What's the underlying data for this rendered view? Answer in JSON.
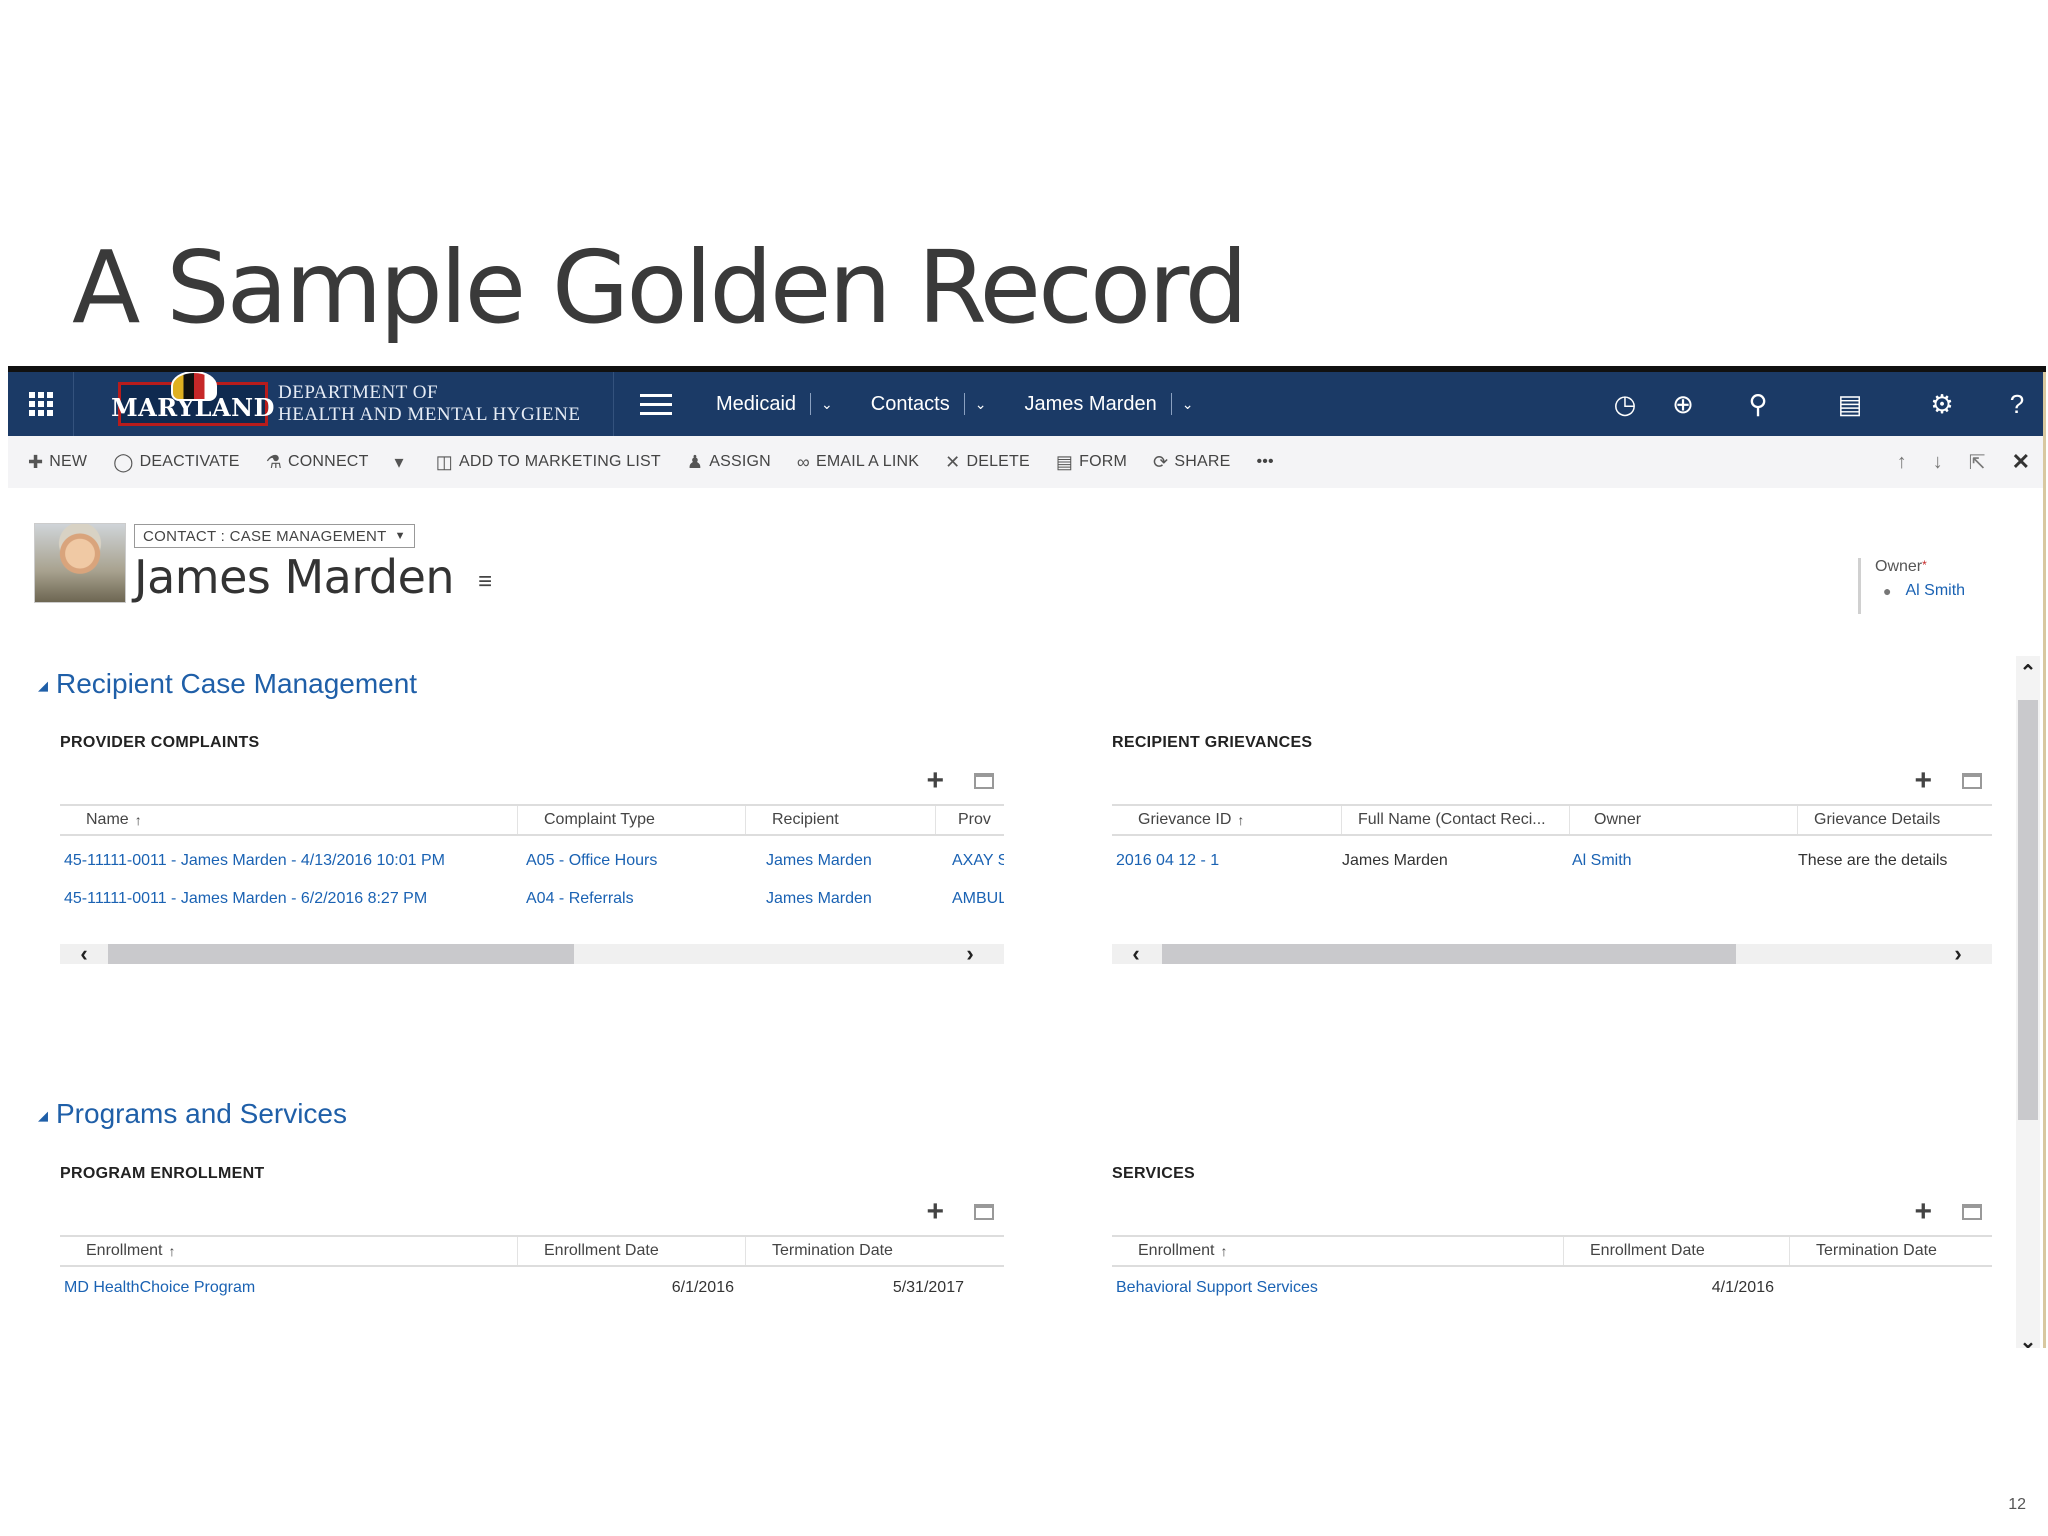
{
  "slide": {
    "title": "A Sample Golden Record",
    "page_number": "12"
  },
  "navbar": {
    "logo_word": "MARYLAND",
    "dept_line1": "DEPARTMENT OF",
    "dept_line2": "HEALTH AND MENTAL HYGIENE",
    "crumbs": [
      "Medicaid",
      "Contacts",
      "James Marden"
    ],
    "icons": [
      "grid-icon",
      "hamburger-icon",
      "history-icon",
      "add-icon",
      "search-icon",
      "advanced-find-icon",
      "gear-icon",
      "help-icon"
    ],
    "help": "?",
    "bg_color": "#1b3a66"
  },
  "commands": {
    "new": "NEW",
    "deactivate": "DEACTIVATE",
    "connect": "CONNECT",
    "add_to_marketing_list": "ADD TO MARKETING LIST",
    "assign": "ASSIGN",
    "email_a_link": "EMAIL A LINK",
    "delete": "DELETE",
    "form": "FORM",
    "share": "SHARE",
    "more": "•••"
  },
  "record": {
    "form_selector": "CONTACT : CASE MANAGEMENT",
    "name": "James Marden",
    "owner_label": "Owner",
    "owner_required": "*",
    "owner_value": "Al Smith"
  },
  "sections": {
    "case_management": "Recipient Case Management",
    "programs": "Programs and Services"
  },
  "provider_complaints": {
    "title": "PROVIDER COMPLAINTS",
    "columns": [
      "Name",
      "Complaint Type",
      "Recipient",
      "Prov"
    ],
    "rows": [
      [
        "45-11111-0011 - James Marden - 4/13/2016 10:01 PM",
        "A05 - Office Hours",
        "James Marden",
        "AXAY S"
      ],
      [
        "45-11111-0011 - James Marden - 6/2/2016 8:27 PM",
        "A04 - Referrals",
        "James Marden",
        "AMBUL"
      ]
    ]
  },
  "recipient_grievances": {
    "title": "RECIPIENT GRIEVANCES",
    "columns": [
      "Grievance ID",
      "Full Name (Contact Reci...",
      "Owner",
      "Grievance Details"
    ],
    "rows": [
      [
        "2016 04 12 - 1",
        "James Marden",
        "Al Smith",
        "These are the details"
      ]
    ]
  },
  "program_enrollment": {
    "title": "PROGRAM ENROLLMENT",
    "columns": [
      "Enrollment",
      "Enrollment Date",
      "Termination Date"
    ],
    "rows": [
      [
        "MD HealthChoice Program",
        "6/1/2016",
        "5/31/2017"
      ]
    ]
  },
  "services": {
    "title": "SERVICES",
    "columns": [
      "Enrollment",
      "Enrollment Date",
      "Termination Date"
    ],
    "rows": [
      [
        "Behavioral Support Services",
        "4/1/2016",
        ""
      ]
    ]
  },
  "colors": {
    "link": "#1a62b3",
    "section_title": "#1f5fa8",
    "navbar": "#1b3a66"
  }
}
